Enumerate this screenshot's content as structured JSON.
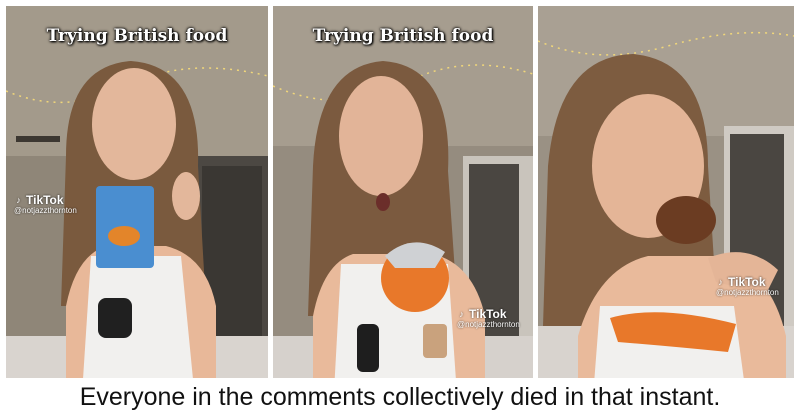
{
  "panels": [
    {
      "title": "Trying British food",
      "watermark": {
        "brand": "TikTok",
        "handle": "@notjazzthornton"
      }
    },
    {
      "title": "Trying British food",
      "watermark": {
        "brand": "TikTok",
        "handle": "@notjazzthornton"
      }
    },
    {
      "title": "",
      "watermark": {
        "brand": "TikTok",
        "handle": "@notjazzthornton"
      }
    }
  ],
  "caption": "Everyone in the comments collectively died in that instant.",
  "icons": [
    "tiktok-note-icon"
  ],
  "colors": {
    "caption_bg": "#ffffff",
    "caption_text": "#111111",
    "title_text": "#ffffff",
    "foil": "#e8782a"
  }
}
